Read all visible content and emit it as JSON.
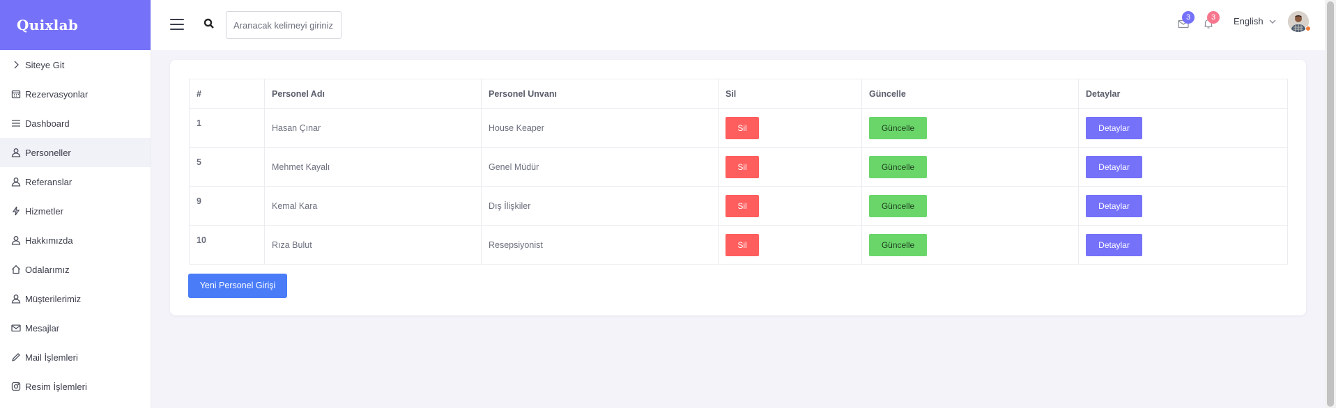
{
  "brand": {
    "name": "Quixlab"
  },
  "sidebar": {
    "items": [
      {
        "label": "Siteye Git",
        "icon": "chevron-right-icon"
      },
      {
        "label": "Rezervasyonlar",
        "icon": "calendar-icon"
      },
      {
        "label": "Dashboard",
        "icon": "menu-icon"
      },
      {
        "label": "Personeller",
        "icon": "user-icon",
        "active": true
      },
      {
        "label": "Referanslar",
        "icon": "user-icon"
      },
      {
        "label": "Hizmetler",
        "icon": "bolt-icon"
      },
      {
        "label": "Hakkımızda",
        "icon": "user-icon"
      },
      {
        "label": "Odalarımız",
        "icon": "home-icon"
      },
      {
        "label": "Müşterilerimiz",
        "icon": "user-icon"
      },
      {
        "label": "Mesajlar",
        "icon": "mail-icon"
      },
      {
        "label": "Mail İşlemleri",
        "icon": "pencil-icon"
      },
      {
        "label": "Resim İşlemleri",
        "icon": "instagram-icon"
      }
    ]
  },
  "header": {
    "search_placeholder": "Aranacak kelimeyi giriniz",
    "mail_badge": "3",
    "notification_badge": "3",
    "language": "English"
  },
  "table": {
    "headers": [
      "#",
      "Personel Adı",
      "Personel Unvanı",
      "Sil",
      "Güncelle",
      "Detaylar"
    ],
    "rows": [
      {
        "id": "1",
        "name": "Hasan Çınar",
        "title": "House Keaper",
        "delete": "Sil",
        "update": "Güncelle",
        "details": "Detaylar"
      },
      {
        "id": "5",
        "name": "Mehmet Kayalı",
        "title": "Genel Müdür",
        "delete": "Sil",
        "update": "Güncelle",
        "details": "Detaylar"
      },
      {
        "id": "9",
        "name": "Kemal Kara",
        "title": "Dış İlişkiler",
        "delete": "Sil",
        "update": "Güncelle",
        "details": "Detaylar"
      },
      {
        "id": "10",
        "name": "Rıza Bulut",
        "title": "Resepsiyonist",
        "delete": "Sil",
        "update": "Güncelle",
        "details": "Detaylar"
      }
    ]
  },
  "actions": {
    "new_personnel": "Yeni Personel Girişi"
  },
  "colors": {
    "brand": "#7571f9",
    "delete": "#ff5e5e",
    "update": "#6ad66a",
    "details": "#7571f9",
    "primary": "#4a7cf8",
    "mail_badge": "#7571f9",
    "notification_badge": "#f7768e"
  }
}
